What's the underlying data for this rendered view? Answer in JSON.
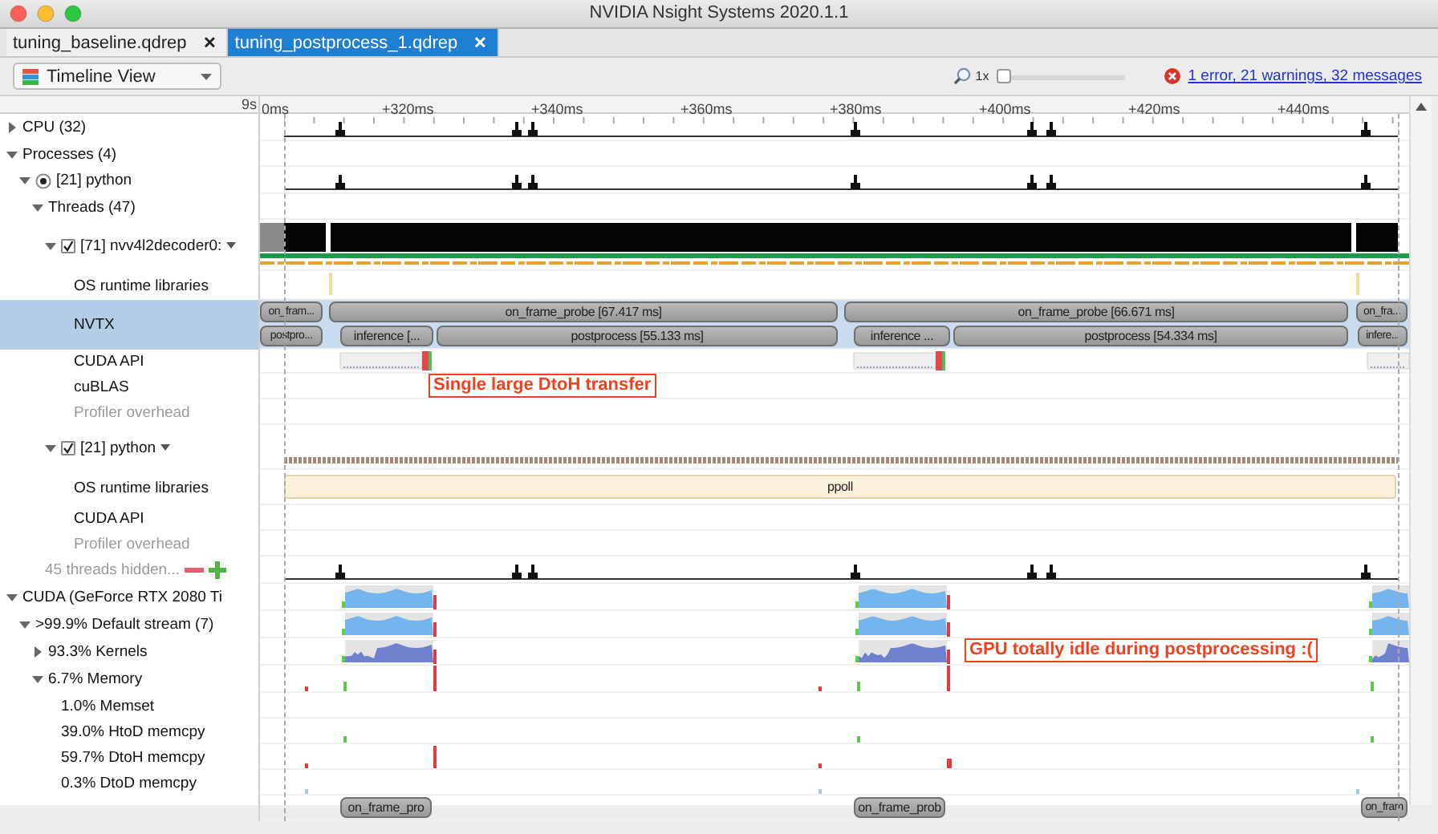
{
  "window": {
    "title": "NVIDIA Nsight Systems 2020.1.1"
  },
  "tabs": [
    {
      "label": "tuning_baseline.qdrep",
      "close": "✕",
      "selected": false
    },
    {
      "label": "tuning_postprocess_1.qdrep",
      "close": "✕",
      "selected": true
    }
  ],
  "toolbar": {
    "view": "Timeline View",
    "zoom_label": "1x",
    "zoom": {
      "level": 0
    },
    "diagnostics": "1 error, 21 warnings, 32 messages"
  },
  "ruler": {
    "offset": "9s",
    "ticks": [
      "0ms",
      "+320ms",
      "+340ms",
      "+360ms",
      "+380ms",
      "+400ms",
      "+420ms",
      "+440ms"
    ]
  },
  "tree": [
    {
      "label": "CPU (32)",
      "kind": "group",
      "expanded": false,
      "selected": false,
      "muted": false,
      "track": {
        "kind": "cpu"
      }
    },
    {
      "label": "Processes (4)",
      "kind": "group",
      "expanded": true,
      "selected": false,
      "muted": false,
      "track": {
        "kind": "empty"
      },
      "children": [
        {
          "label": "[21] python",
          "kind": "process",
          "expanded": true,
          "radio": true,
          "selected": false,
          "muted": false,
          "track": {
            "kind": "cpu"
          },
          "children": [
            {
              "label": "Threads (47)",
              "kind": "group",
              "expanded": true,
              "selected": false,
              "muted": false,
              "track": {
                "kind": "empty"
              },
              "children": [
                {
                  "label": "[71] nvv4l2decoder0:",
                  "kind": "thread",
                  "expanded": true,
                  "checked": true,
                  "selected": false,
                  "muted": false,
                  "track": {
                    "kind": "thread"
                  },
                  "children": [
                    {
                      "label": "OS runtime libraries",
                      "kind": "leaf",
                      "selected": false,
                      "muted": false,
                      "track": {
                        "kind": "osrt"
                      }
                    },
                    {
                      "label": "NVTX",
                      "kind": "leaf",
                      "selected": true,
                      "muted": false,
                      "track": {
                        "kind": "nvtx",
                        "lanes": [
                          [
                            "on_fram...",
                            "on_frame_probe [67.417 ms]",
                            "on_frame_probe [66.671 ms]",
                            "on_fra..."
                          ],
                          [
                            "postpro...",
                            "inference [...",
                            "postprocess [55.133 ms]",
                            "inference ...",
                            "postprocess [54.334 ms]",
                            "infere..."
                          ]
                        ]
                      }
                    },
                    {
                      "label": "CUDA API",
                      "kind": "leaf",
                      "selected": false,
                      "muted": false,
                      "track": {
                        "kind": "cudaapi"
                      }
                    },
                    {
                      "label": "cuBLAS",
                      "kind": "leaf",
                      "selected": false,
                      "muted": false,
                      "track": {
                        "kind": "empty",
                        "annotation": "Single large DtoH transfer"
                      }
                    },
                    {
                      "label": "Profiler overhead",
                      "kind": "leaf",
                      "selected": false,
                      "muted": true,
                      "track": {
                        "kind": "empty"
                      }
                    }
                  ]
                },
                {
                  "label": "[21] python",
                  "kind": "thread",
                  "expanded": true,
                  "checked": true,
                  "selected": false,
                  "muted": false,
                  "track": {
                    "kind": "band"
                  },
                  "children": [
                    {
                      "label": "OS runtime libraries",
                      "kind": "leaf",
                      "selected": false,
                      "muted": false,
                      "track": {
                        "kind": "osrt-range",
                        "lanes": [
                          [
                            "ppoll"
                          ]
                        ]
                      }
                    },
                    {
                      "label": "CUDA API",
                      "kind": "leaf",
                      "selected": false,
                      "muted": false,
                      "track": {
                        "kind": "empty"
                      }
                    },
                    {
                      "label": "Profiler overhead",
                      "kind": "leaf",
                      "selected": false,
                      "muted": true,
                      "track": {
                        "kind": "empty"
                      }
                    }
                  ]
                },
                {
                  "label": "45 threads hidden...",
                  "kind": "hidden",
                  "selected": false,
                  "muted": true,
                  "track": {
                    "kind": "cpu"
                  }
                }
              ]
            }
          ]
        }
      ]
    },
    {
      "label": "CUDA (GeForce RTX 2080 Ti",
      "kind": "group",
      "expanded": true,
      "selected": false,
      "muted": false,
      "track": {
        "kind": "gpu"
      },
      "children": [
        {
          "label": ">99.9% Default stream (7)",
          "kind": "group",
          "expanded": true,
          "selected": false,
          "muted": false,
          "track": {
            "kind": "gpu"
          },
          "children": [
            {
              "label": "93.3% Kernels",
              "kind": "group",
              "expanded": false,
              "selected": false,
              "muted": false,
              "track": {
                "kind": "kernels",
                "annotation": "GPU totally idle during postprocessing :("
              }
            },
            {
              "label": "6.7% Memory",
              "kind": "group",
              "expanded": true,
              "selected": false,
              "muted": false,
              "track": {
                "kind": "memory"
              },
              "children": [
                {
                  "label": "1.0% Memset",
                  "kind": "leaf",
                  "selected": false,
                  "muted": false,
                  "track": {
                    "kind": "empty"
                  }
                },
                {
                  "label": "39.0% HtoD memcpy",
                  "kind": "leaf",
                  "selected": false,
                  "muted": false,
                  "track": {
                    "kind": "htod"
                  }
                },
                {
                  "label": "59.7% DtoH memcpy",
                  "kind": "leaf",
                  "selected": false,
                  "muted": false,
                  "track": {
                    "kind": "dtoh"
                  }
                },
                {
                  "label": "0.3% DtoD memcpy",
                  "kind": "leaf",
                  "selected": false,
                  "muted": false,
                  "track": {
                    "kind": "dtod"
                  }
                }
              ]
            }
          ]
        }
      ]
    },
    {
      "track": {
        "kind": "tail",
        "lanes": [
          [
            "on_frame_pro",
            "on_frame_prob",
            "on_fram"
          ]
        ]
      }
    }
  ]
}
